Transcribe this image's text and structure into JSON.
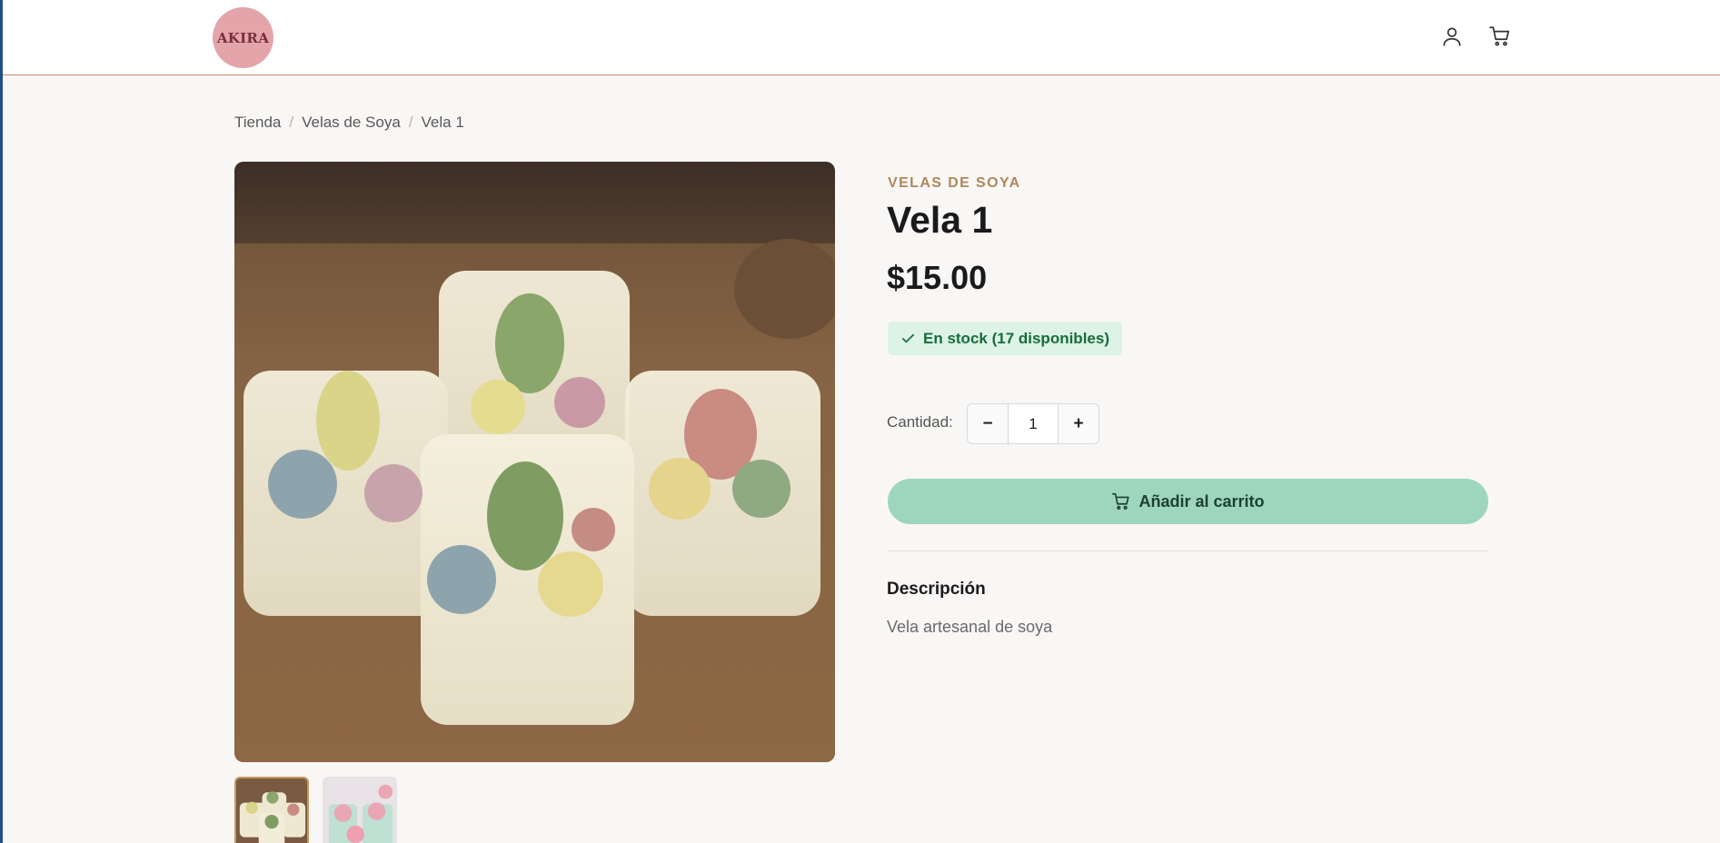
{
  "header": {
    "logo_text": "AKIRA",
    "user_icon": "user-icon",
    "cart_icon": "cart-icon"
  },
  "breadcrumb": {
    "items": [
      "Tienda",
      "Velas de Soya",
      "Vela 1"
    ],
    "separator": "/"
  },
  "product": {
    "category": "VELAS DE SOYA",
    "title": "Vela 1",
    "price": "$15.00",
    "stock_text": "En stock (17 disponibles)",
    "quantity_label": "Cantidad:",
    "quantity_value": "1",
    "decrement_label": "−",
    "increment_label": "+",
    "add_to_cart_label": "Añadir al carrito",
    "description_heading": "Descripción",
    "description_text": "Vela artesanal de soya"
  },
  "colors": {
    "accent_category": "#b0875a",
    "stock_bg": "#dcf3e5",
    "stock_text": "#176c3b",
    "add_to_cart_bg": "#9ed6bd",
    "header_border": "#c9836f",
    "logo_bg": "#e3a4aa"
  }
}
